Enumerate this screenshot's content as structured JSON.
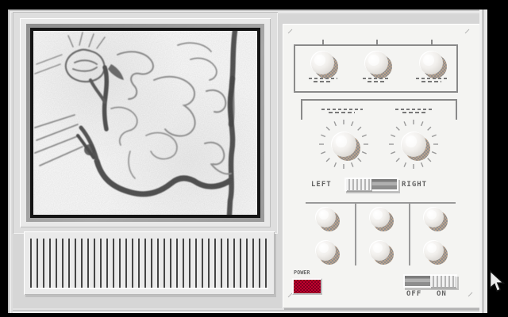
{
  "device": {
    "kind": "tv-monitor-with-control-panel"
  },
  "screen": {
    "image": "angiogram-sketch"
  },
  "controls": {
    "top_section": {
      "knob_count": 3,
      "labels_illegible": true
    },
    "tuning_section": {
      "knob_count": 2,
      "labels_illegible": true
    },
    "balance": {
      "left": "LEFT",
      "right": "RIGHT",
      "position": "left"
    },
    "grid_section": {
      "knob_count": 6
    },
    "power_light": {
      "label": "POWER",
      "color": "#a00028",
      "state": "on"
    },
    "power_switch": {
      "off": "OFF",
      "on": "ON",
      "state": "on"
    }
  },
  "colors": {
    "body": "#d6d6d6",
    "panel": "#f4f4f2",
    "screen_bg": "#fafafa",
    "indicator_red": "#a00028"
  }
}
